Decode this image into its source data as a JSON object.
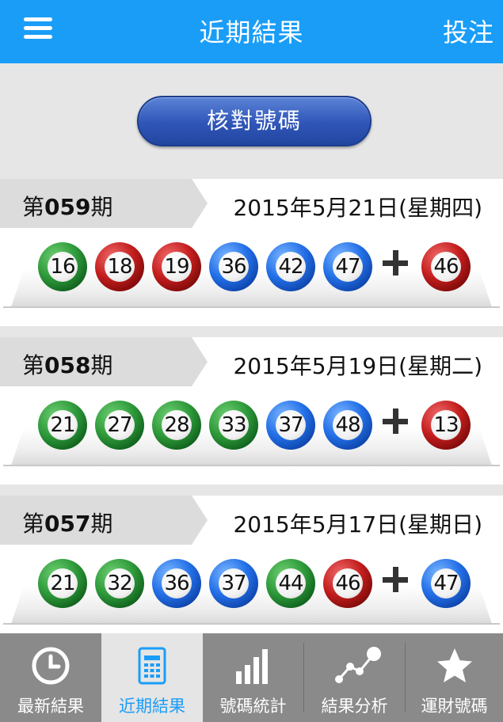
{
  "header": {
    "title": "近期結果",
    "bet_label": "投注"
  },
  "check_button": {
    "label": "核對號碼"
  },
  "draws": [
    {
      "prefix": "第",
      "number": "059",
      "suffix": "期",
      "date": "2015年5月21日(星期四)",
      "balls": [
        {
          "n": "16",
          "color": "green"
        },
        {
          "n": "18",
          "color": "red"
        },
        {
          "n": "19",
          "color": "red"
        },
        {
          "n": "36",
          "color": "blue"
        },
        {
          "n": "42",
          "color": "blue"
        },
        {
          "n": "47",
          "color": "blue"
        }
      ],
      "special": {
        "n": "46",
        "color": "red"
      }
    },
    {
      "prefix": "第",
      "number": "058",
      "suffix": "期",
      "date": "2015年5月19日(星期二)",
      "balls": [
        {
          "n": "21",
          "color": "green"
        },
        {
          "n": "27",
          "color": "green"
        },
        {
          "n": "28",
          "color": "green"
        },
        {
          "n": "33",
          "color": "green"
        },
        {
          "n": "37",
          "color": "blue"
        },
        {
          "n": "48",
          "color": "blue"
        }
      ],
      "special": {
        "n": "13",
        "color": "red"
      }
    },
    {
      "prefix": "第",
      "number": "057",
      "suffix": "期",
      "date": "2015年5月17日(星期日)",
      "balls": [
        {
          "n": "21",
          "color": "green"
        },
        {
          "n": "32",
          "color": "green"
        },
        {
          "n": "36",
          "color": "blue"
        },
        {
          "n": "37",
          "color": "blue"
        },
        {
          "n": "44",
          "color": "green"
        },
        {
          "n": "46",
          "color": "red"
        }
      ],
      "special": {
        "n": "47",
        "color": "blue"
      }
    }
  ],
  "tabs": [
    {
      "label": "最新結果",
      "icon": "clock-icon",
      "active": false
    },
    {
      "label": "近期結果",
      "icon": "calendar-icon",
      "active": true
    },
    {
      "label": "號碼統計",
      "icon": "bar-chart-icon",
      "active": false
    },
    {
      "label": "結果分析",
      "icon": "trend-icon",
      "active": false
    },
    {
      "label": "運財號碼",
      "icon": "star-icon",
      "active": false
    }
  ],
  "colors": {
    "header": "#1a9df7",
    "tabbar": "#8a8a8a",
    "active_tab_text": "#1a9df7"
  }
}
